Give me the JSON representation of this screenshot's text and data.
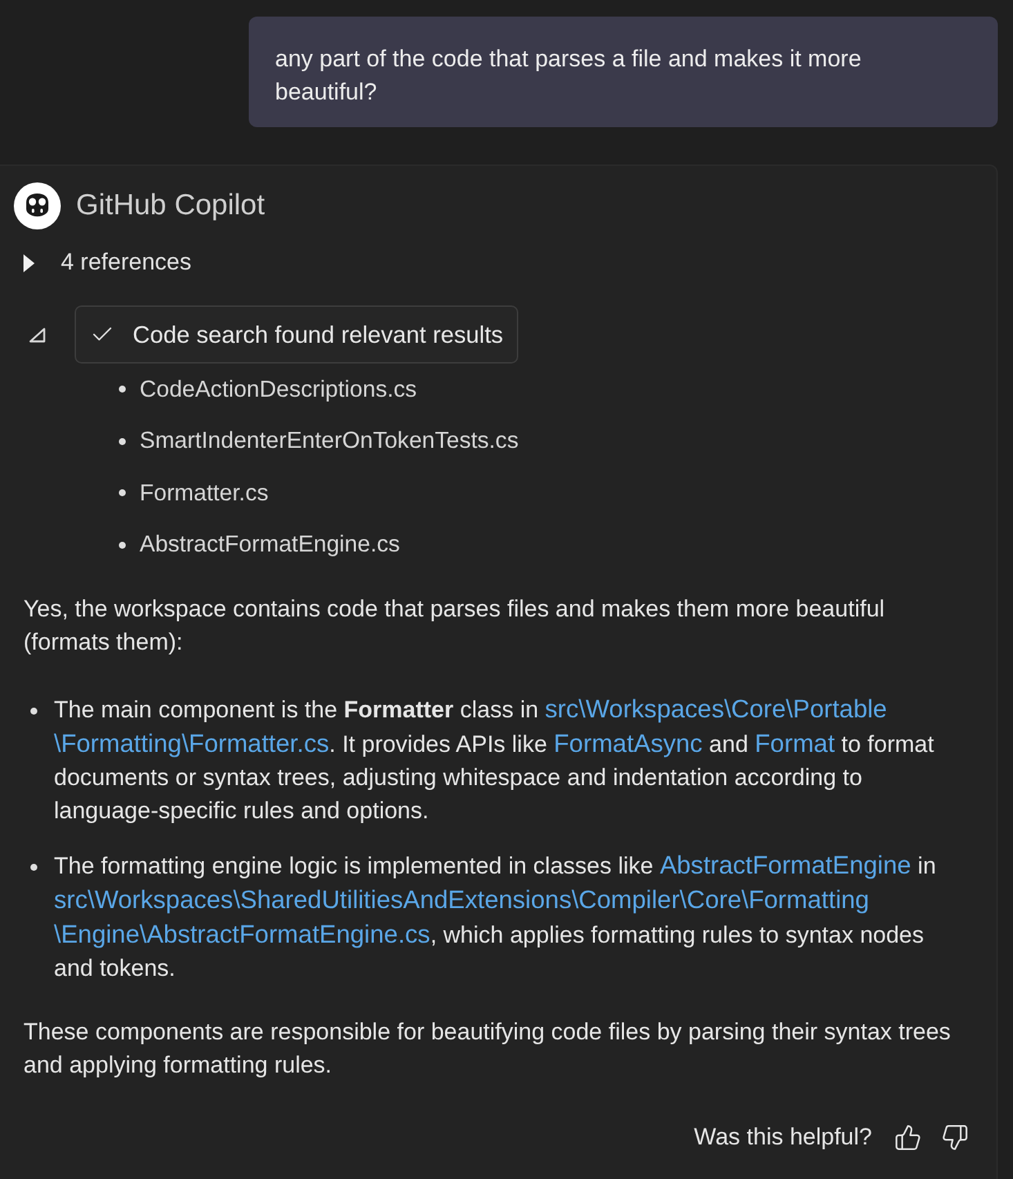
{
  "user_message": {
    "text": "any part of the code that parses a file and makes it more beautiful?"
  },
  "response": {
    "author": "GitHub Copilot",
    "references": {
      "label": "4 references",
      "expanded": false
    },
    "search_step": {
      "label": "Code search found relevant results",
      "expanded": true,
      "files": [
        "CodeActionDescriptions.cs",
        "SmartIndenterEnterOnTokenTests.cs",
        "Formatter.cs",
        "AbstractFormatEngine.cs"
      ]
    },
    "intro": "Yes, the workspace contains code that parses files and makes them more beautiful (formats them):",
    "bullets": [
      {
        "runs": [
          {
            "kind": "text",
            "text": "The main component is the **Formatter** class in "
          },
          {
            "kind": "link",
            "text": "src\\Workspaces\\Core\\Portable"
          },
          {
            "kind": "link",
            "text": "\\Formatting\\Formatter.cs"
          },
          {
            "kind": "text",
            "text": ". It provides APIs like "
          },
          {
            "kind": "link",
            "text": "FormatAsync"
          },
          {
            "kind": "text",
            "text": " and "
          },
          {
            "kind": "link",
            "text": "Format"
          },
          {
            "kind": "text",
            "text": " to format documents or syntax trees, adjusting whitespace and indentation according to language-specific rules and options."
          }
        ]
      },
      {
        "runs": [
          {
            "kind": "text",
            "text": "The formatting engine logic is implemented in classes like "
          },
          {
            "kind": "link",
            "text": "AbstractFormatEngine"
          },
          {
            "kind": "text",
            "text": " in "
          },
          {
            "kind": "link",
            "text": "src\\Workspaces\\SharedUtilitiesAndExtensions\\Compiler\\Core\\Formatting"
          },
          {
            "kind": "link",
            "text": "\\Engine\\AbstractFormatEngine.cs"
          },
          {
            "kind": "text",
            "text": ", which applies formatting rules to syntax nodes and tokens."
          }
        ]
      }
    ],
    "summary": "These components are responsible for beautifying code files by parsing their syntax trees and applying formatting rules.",
    "feedback": {
      "prompt": "Was this helpful?"
    }
  }
}
